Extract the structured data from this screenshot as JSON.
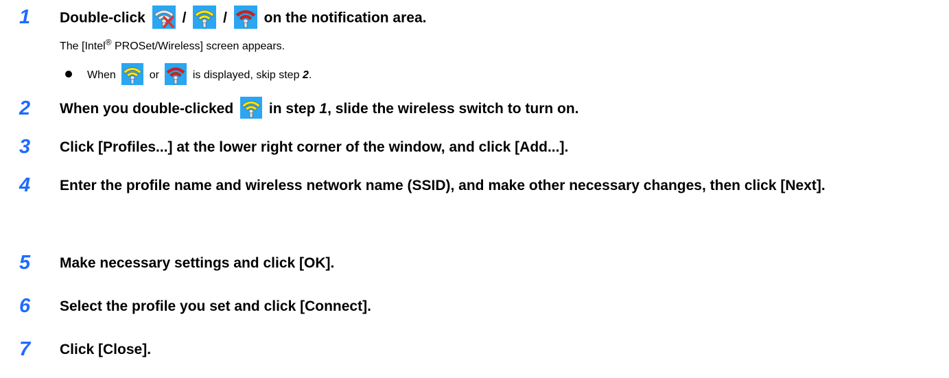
{
  "steps": [
    {
      "number": "1",
      "pre": "Double-click",
      "sep1": "/",
      "sep2": "/",
      "post": "on the notification area.",
      "sub_pre": "The [Intel",
      "sub_sup": "®",
      "sub_post": " PROSet/Wireless] screen appears.",
      "bullet_pre": "When",
      "bullet_or": "or",
      "bullet_post": "is displayed, skip step",
      "bullet_ref": "2",
      "bullet_end": "."
    },
    {
      "number": "2",
      "pre": "When you double-clicked",
      "mid": "in step",
      "ref": "1",
      "post": ", slide the wireless switch to turn on."
    },
    {
      "number": "3",
      "text": "Click [Profiles...] at the lower right corner of the window, and click [Add...]."
    },
    {
      "number": "4",
      "text": "Enter the profile name and wireless network name (SSID), and make other necessary changes, then click [Next]."
    },
    {
      "number": "5",
      "text": "Make necessary settings and click [OK]."
    },
    {
      "number": "6",
      "text": "Select the profile you set and click [Connect]."
    },
    {
      "number": "7",
      "text": "Click [Close]."
    }
  ],
  "icons": {
    "wifi_off": "wireless-off-icon",
    "wifi_yellow": "wireless-yellow-icon",
    "wifi_red": "wireless-red-icon"
  },
  "colors": {
    "step_number": "#1e6bff",
    "icon_bg": "#2aa6f2",
    "wifi_yellow": "#ffe600",
    "wifi_red": "#e01818",
    "wifi_off": "#e8e8e8",
    "x_mark": "#e0302a"
  }
}
